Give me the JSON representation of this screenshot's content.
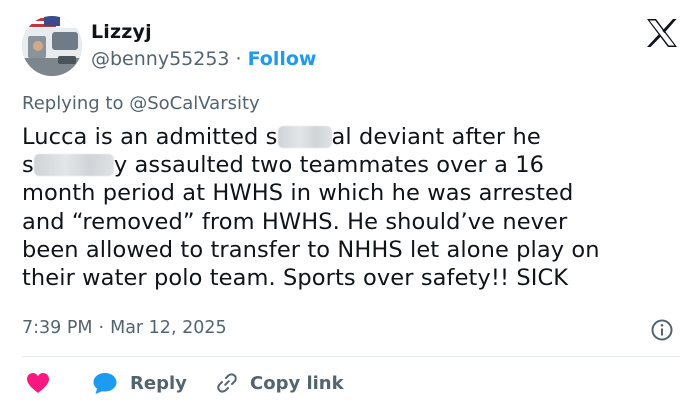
{
  "author": {
    "display_name": "Lizzyj",
    "handle": "@benny55253",
    "separator": "·",
    "follow_label": "Follow"
  },
  "reply_context": {
    "prefix": "Replying to",
    "mention": "@SoCalVarsity"
  },
  "tweet": {
    "lines": [
      "Lucca is an admitted s",
      "al deviant after he",
      "s",
      "y assaulted two teammates over a 16",
      "month period  at HWHS in which he was arrested",
      "and “removed” from HWHS. He should’ve never",
      "been allowed to transfer to NHHS let alone play on",
      "their water polo team. Sports over safety!! SICK"
    ]
  },
  "meta": {
    "time": "7:39 PM",
    "separator": "·",
    "date": "Mar 12, 2025"
  },
  "actions": {
    "reply_label": "Reply",
    "copy_link_label": "Copy link"
  },
  "icons": {
    "logo": "x-logo-icon",
    "info": "info-icon",
    "like": "heart-icon",
    "reply": "reply-bubble-icon",
    "copy": "link-icon"
  },
  "colors": {
    "text": "#0f1419",
    "secondary": "#536471",
    "accent": "#1d9bf0",
    "like": "#f91880",
    "divider": "#e6ecf0"
  }
}
